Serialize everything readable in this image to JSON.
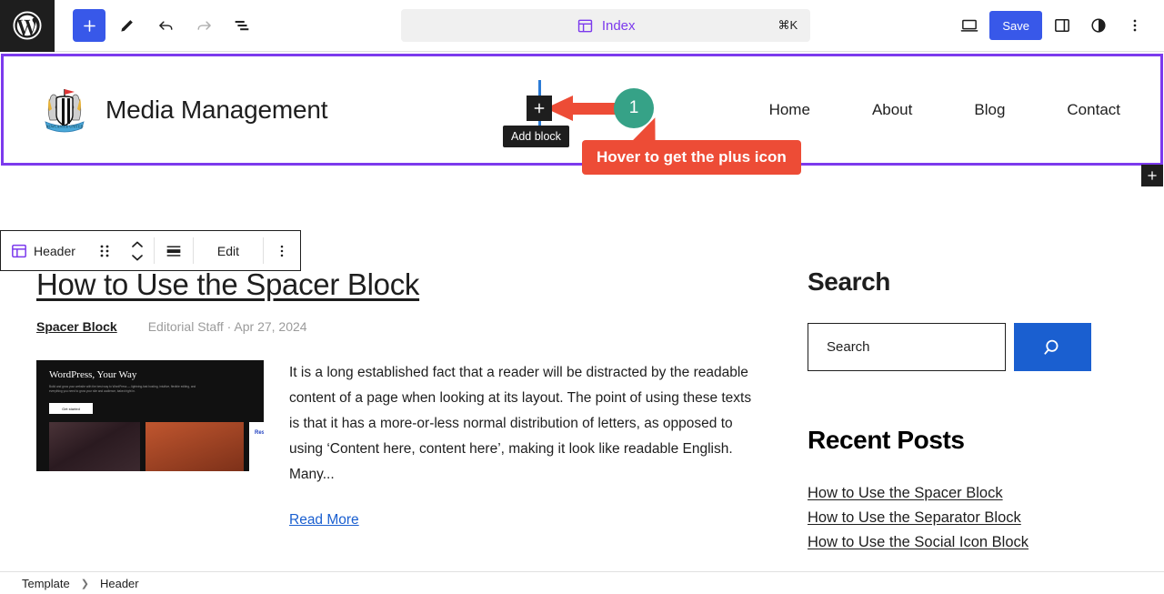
{
  "toolbar": {
    "wp_logo": "wordpress-logo",
    "add_block_label": "Add block",
    "tools_label": "Tools",
    "undo_label": "Undo",
    "redo_label": "Redo",
    "overview_label": "Document Overview",
    "command_bar": {
      "label": "Index",
      "shortcut": "⌘K",
      "icon": "template-icon"
    },
    "device_label": "View",
    "save_label": "Save",
    "settings_label": "Settings",
    "styles_label": "Styles",
    "options_label": "Options"
  },
  "block_toolbar": {
    "block_name": "Header",
    "block_icon": "header-block-icon",
    "drag_label": "Drag",
    "move_label": "Move up or down",
    "align_label": "Align",
    "edit_label": "Edit",
    "more_label": "Options"
  },
  "site_header": {
    "logo": "newcastle-crest-logo",
    "title": "Media Management",
    "nav": [
      {
        "label": "Home"
      },
      {
        "label": "About"
      },
      {
        "label": "Blog"
      },
      {
        "label": "Contact"
      }
    ]
  },
  "post": {
    "title": "How to Use the Spacer Block",
    "category": "Spacer Block",
    "byline": "Editorial Staff · Apr 27, 2024",
    "featured_image": {
      "heading": "WordPress, Your Way",
      "subtext": "Build and grow your website with the best way to WordPress — lightning-fast hosting, intuitive, flexible editing, and everything you need to grow your site and audience, baked right in.",
      "button": "Get started",
      "thumb3_text": "Resilie Relianc"
    },
    "excerpt": "It is a long established fact that a reader will be distracted by the readable content of a page when looking at its layout. The point of using these texts is that it has a more-or-less normal distribution of letters, as opposed to using ‘Content here, content here’, making it look like readable English. Many...",
    "read_more": "Read More"
  },
  "sidebar": {
    "search_heading": "Search",
    "search_placeholder": "Search",
    "search_button_icon": "search-icon",
    "recent_heading": "Recent Posts",
    "recent_posts": [
      {
        "label": "How to Use the Spacer Block"
      },
      {
        "label": "How to Use the Separator Block"
      },
      {
        "label": "How to Use the Social Icon Block"
      }
    ]
  },
  "footer": {
    "crumbs": [
      {
        "label": "Template"
      },
      {
        "label": "Header"
      }
    ],
    "separator": "❯"
  },
  "annotation": {
    "step_number": "1",
    "callout": "Hover to get the plus icon",
    "tooltip": "Add block",
    "colors": {
      "accent_red": "#ed4c36",
      "badge_teal": "#36a287",
      "selection_purple": "#7c3aed",
      "insert_blue": "#2b7bd6"
    }
  }
}
